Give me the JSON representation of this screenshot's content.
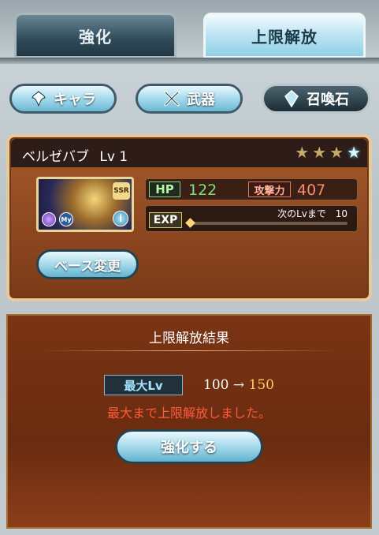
{
  "tabs": [
    {
      "label": "強化",
      "active": false
    },
    {
      "label": "上限解放",
      "active": true
    }
  ],
  "categories": [
    {
      "label": "キャラ",
      "icon": "chara-icon",
      "selected": false
    },
    {
      "label": "武器",
      "icon": "weapon-icon",
      "selected": false
    },
    {
      "label": "召喚石",
      "icon": "summon-icon",
      "selected": true
    }
  ],
  "character": {
    "name": "ベルゼバブ",
    "level_text": "Lv 1",
    "stars_filled": 3,
    "stars_total": 4,
    "rarity": "SSR",
    "element_badge": "My",
    "hp_label": "HP",
    "hp_value": "122",
    "atk_label": "攻撃力",
    "atk_value": "407",
    "exp_label": "EXP",
    "next_level_label": "次のLvまで",
    "next_level_value": "10",
    "exp_progress": 0.0,
    "base_button": "ベース変更"
  },
  "result": {
    "title": "上限解放結果",
    "max_lv_label": "最大Lv",
    "lv_from": "100",
    "arrow": "→",
    "lv_to": "150",
    "message": "最大まで上限解放しました。",
    "enhance_button": "強化する"
  },
  "colors": {
    "hp": "#7ee07a",
    "attack": "#ff8a70",
    "message": "#ff5a3a",
    "new_level": "#ffcc66"
  }
}
